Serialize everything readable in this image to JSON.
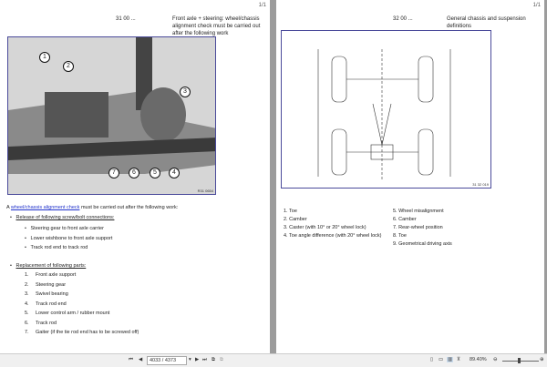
{
  "left_page": {
    "page_marker": "1/1",
    "section": "31 00 ...",
    "title": "Front axle + steering: wheel/chassis alignment check must be carried out after the following work",
    "figure_code": "R31 0654",
    "callouts": [
      "1",
      "2",
      "3",
      "4",
      "5",
      "6",
      "7"
    ],
    "intro_prefix": "A ",
    "intro_link": "wheel/chassis alignment check",
    "intro_suffix": " must be carried out after the following work:",
    "release_heading": "Release of following screw/bolt connections:",
    "release_items": [
      "Steering gear to front axle carrier",
      "Lower wishbone to front axle support",
      "Track rod end to track rod"
    ],
    "replace_heading": "Replacement of following parts:",
    "replace_items": [
      {
        "n": "1.",
        "t": "Front axle support"
      },
      {
        "n": "2.",
        "t": "Steering gear"
      },
      {
        "n": "3.",
        "t": "Swivel bearing"
      },
      {
        "n": "4.",
        "t": "Track rod end"
      },
      {
        "n": "5.",
        "t": "Lower control arm / rubber mount"
      },
      {
        "n": "6.",
        "t": "Track rod"
      },
      {
        "n": "7.",
        "t": "Gaiter (if the tie rod end has to be screwed off)"
      }
    ]
  },
  "right_page": {
    "page_marker": "1/1",
    "section": "32 00 ...",
    "title": "General chassis and suspension definitions",
    "figure_code": "31 32 019",
    "legend_left": [
      "1. Toe",
      "2. Camber",
      "3. Caster (with 10° or 20° wheel lock)",
      "4. Toe angle difference (with 20° wheel lock)"
    ],
    "legend_right": [
      "5. Wheel misalignment",
      "6. Camber",
      "7. Rear-wheel position",
      "8. Toe",
      "9. Geometrical driving axis"
    ]
  },
  "toolbar": {
    "page_field": "4033 / 4373",
    "zoom": "89.40%"
  }
}
